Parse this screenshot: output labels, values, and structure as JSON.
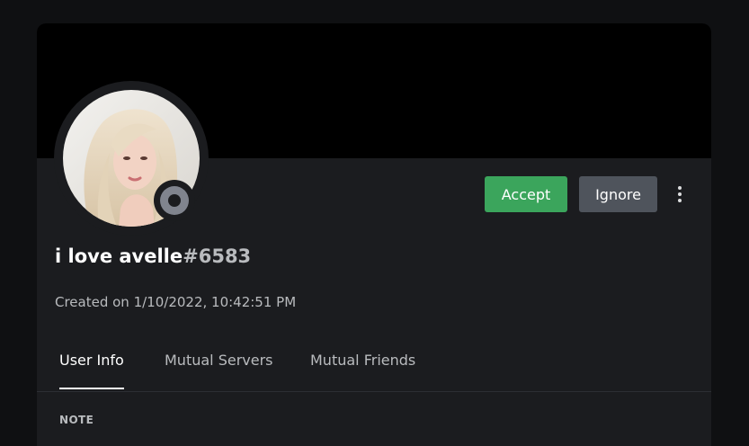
{
  "profile": {
    "username": "i love avelle",
    "discriminator": "#6583",
    "created": "Created on 1/10/2022, 10:42:51 PM",
    "status": "offline"
  },
  "actions": {
    "accept_label": "Accept",
    "ignore_label": "Ignore",
    "more_icon": "vertical-ellipsis-icon"
  },
  "tabs": [
    {
      "label": "User Info",
      "active": true
    },
    {
      "label": "Mutual Servers",
      "active": false
    },
    {
      "label": "Mutual Friends",
      "active": false
    }
  ],
  "section": {
    "title": "NOTE"
  },
  "colors": {
    "accept": "#3ba55c",
    "ignore": "#4f545c",
    "status_offline": "#80848e",
    "banner": "#000000",
    "background": "#1b1c1f"
  }
}
